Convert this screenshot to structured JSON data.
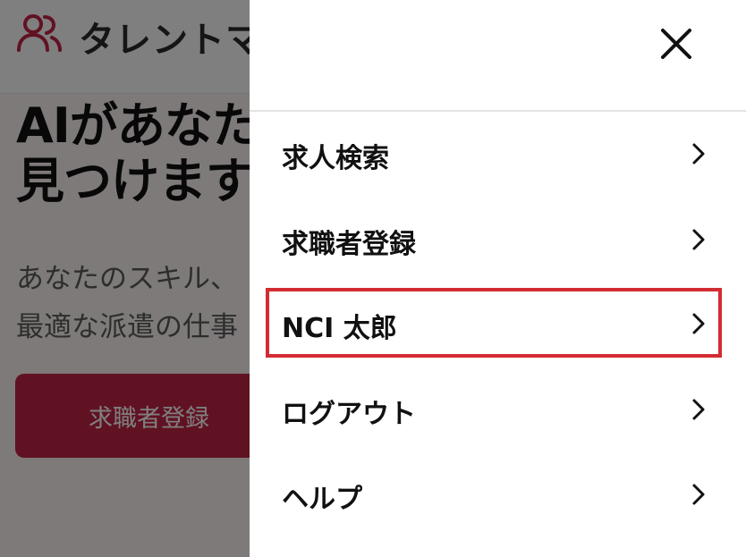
{
  "header": {
    "app_title": "タレントマ",
    "icon": "users-icon"
  },
  "hero": {
    "title_line1": "AIがあなた",
    "title_line2": "見つけます",
    "subtitle_line1": "あなたのスキル、",
    "subtitle_line2": "最適な派遣の仕事",
    "cta_label": "求職者登録"
  },
  "drawer": {
    "close_icon": "close-icon",
    "items": [
      {
        "label": "求人検索",
        "icon": "chevron-right-icon"
      },
      {
        "label": "求職者登録",
        "icon": "chevron-right-icon"
      },
      {
        "label": "NCI 太郎",
        "icon": "chevron-right-icon",
        "highlighted": true
      },
      {
        "label": "ログアウト",
        "icon": "chevron-right-icon"
      },
      {
        "label": "ヘルプ",
        "icon": "chevron-right-icon"
      }
    ],
    "highlight_color": "#d32b33"
  },
  "colors": {
    "accent": "#c22445",
    "overlay": "rgba(0,0,0,0.5)"
  }
}
